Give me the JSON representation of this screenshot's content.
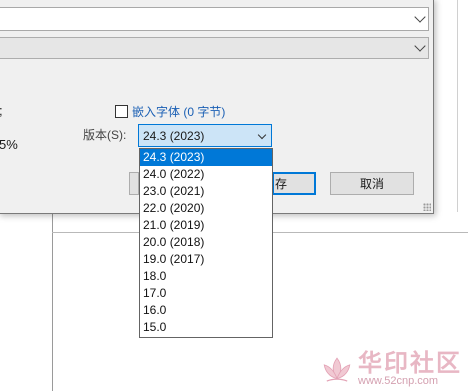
{
  "dialog": {
    "left_texts": [
      ";",
      "5%"
    ],
    "embed_fonts_label": "嵌入字体 (0 字节)",
    "version_label": "版本(S):",
    "version_selected": "24.3 (2023)",
    "save_button_partial": "存",
    "cancel_button": "取消"
  },
  "version_options": [
    "24.3 (2023)",
    "24.0 (2022)",
    "23.0 (2021)",
    "22.0 (2020)",
    "21.0 (2019)",
    "20.0 (2018)",
    "19.0 (2017)",
    "18.0",
    "17.0",
    "16.0",
    "15.0"
  ],
  "selected_index": 0,
  "colors": {
    "selection": "#0078d7",
    "link_blue": "#1a5fb4",
    "watermark_pink": "#e8b7c4"
  },
  "watermark": {
    "title": "华印社区",
    "url": "www.52cnp.com"
  }
}
